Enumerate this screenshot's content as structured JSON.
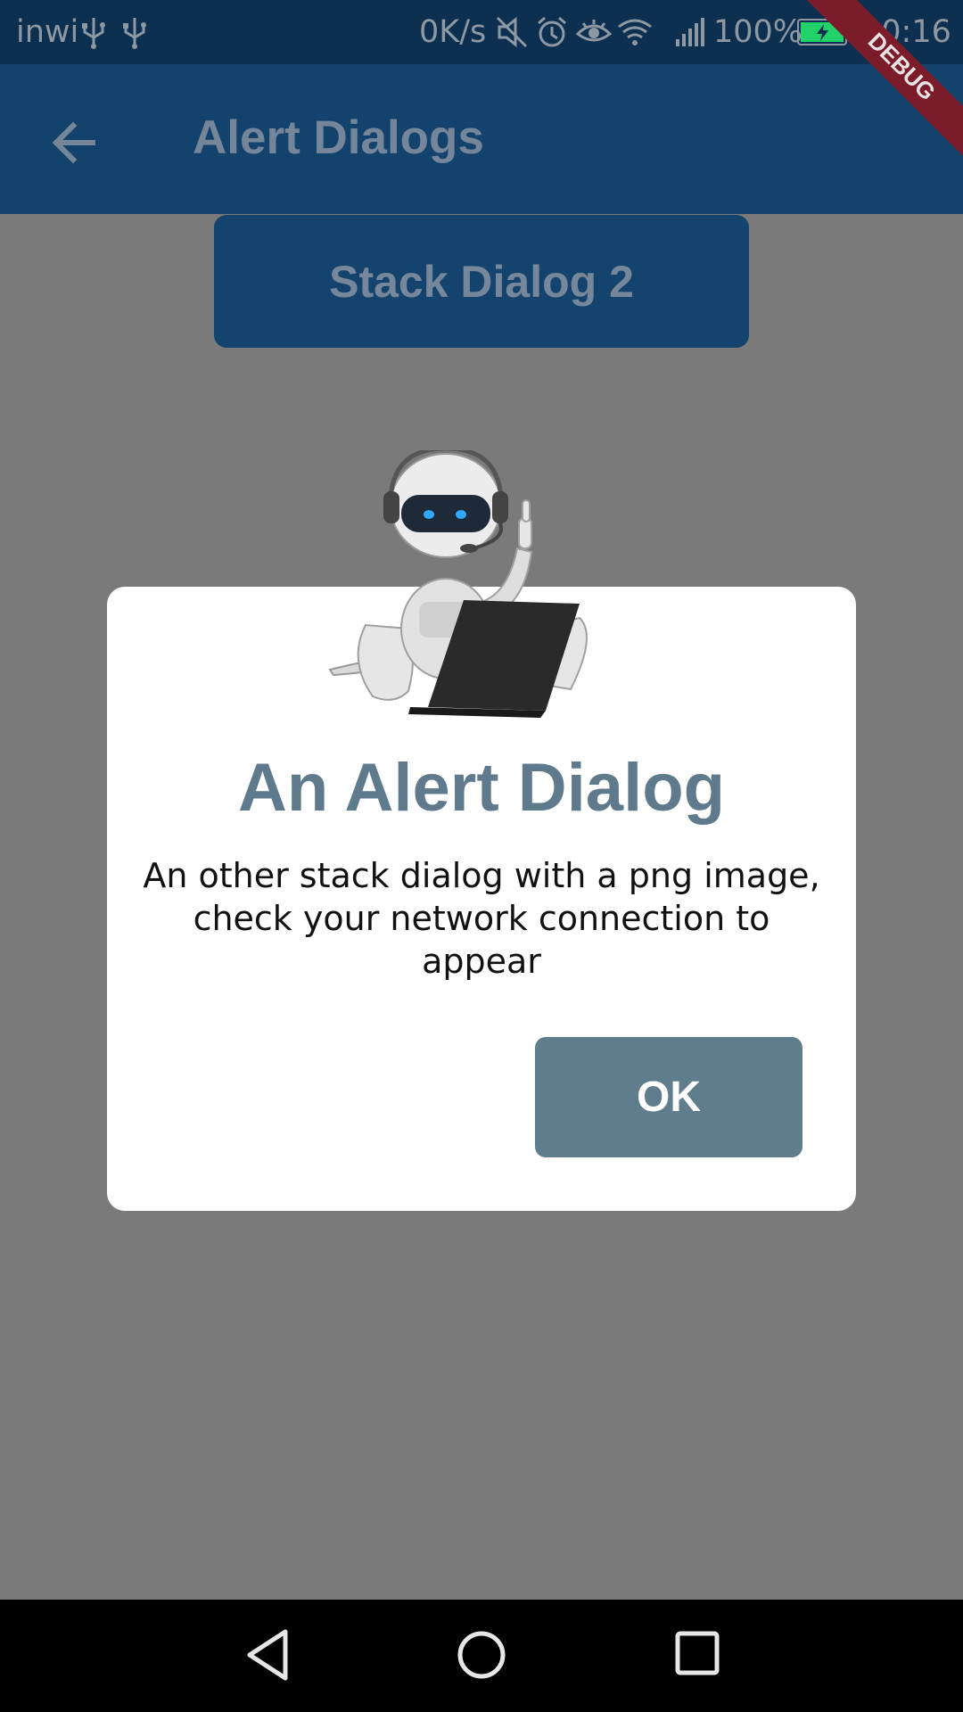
{
  "status_bar": {
    "carrier": "inwi",
    "network_speed": "0K/s",
    "battery": "100%",
    "time": "20:16",
    "icons": [
      "usb-icon",
      "usb-icon",
      "mute-icon",
      "alarm-icon",
      "eye-icon",
      "wifi-icon",
      "signal-icon",
      "battery-icon"
    ]
  },
  "debug_banner": "DEBUG",
  "app_bar": {
    "title": "Alert Dialogs",
    "back_icon": "arrow-back-icon"
  },
  "page": {
    "button_label": "Stack Dialog 2"
  },
  "dialog": {
    "image": "robot-with-laptop",
    "title": "An Alert Dialog",
    "message": "An other stack dialog with a png image, check your network connection to appear",
    "ok_label": "OK"
  },
  "nav_bar": {
    "icons": [
      "back-nav-icon",
      "home-nav-icon",
      "recents-nav-icon"
    ]
  },
  "colors": {
    "app_bar": "#13436d",
    "scrim": "#7a7a7a",
    "dialog_title": "#5f7a8c",
    "ok_button": "#5f7d8c",
    "debug_banner": "#7b1c2a"
  }
}
